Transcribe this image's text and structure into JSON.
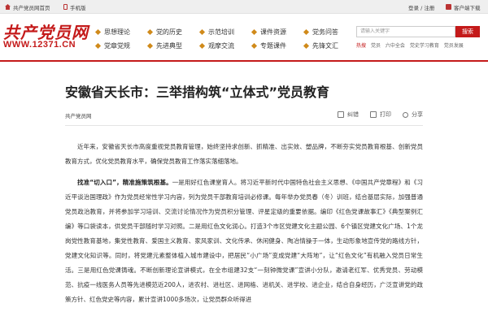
{
  "topbar": {
    "home": "共产党员网首页",
    "mobile": "手机版",
    "auth": "登录 / 注册",
    "download": "客户端下载"
  },
  "logo": {
    "cn": "共产党员网",
    "url": "WWW.12371.CN"
  },
  "nav": [
    "思想理论",
    "党的历史",
    "示范培训",
    "课件资源",
    "党务问答",
    "党章党规",
    "先进典型",
    "观摩交流",
    "专题课件",
    "先锋文汇"
  ],
  "search": {
    "placeholder": "请输入关键字",
    "button": "搜索",
    "hot_label": "热搜",
    "hot_tags": [
      "党员",
      "六中全会",
      "党史学习教育",
      "党员发展"
    ]
  },
  "article": {
    "title": "安徽省天长市：三举措构筑“立体式”党员教育",
    "source": "共产党员网",
    "tools": {
      "correct": "纠错",
      "print": "打印",
      "share": "分享"
    },
    "p1": "近年来，安徽省天长市高度重视党员教育管理，始终坚持求创新、抓精准、出实效、塑品牌，不断夯实党员教育根基、创新党员教育方式，优化党员教育水平，确保党员教育工作落实落细落地。",
    "p2_lead": "找准“切入口”，精准施策筑根基。",
    "p2_body": "一是用好红色课堂育人。将习近平新时代中国特色社会主义思想、《中国共产党章程》和《习近平谈治国理政》作为党员经常性学习内容，列为党员干部教育培训必修课。每年举办党员春（冬）训班，结合基层实际，加强普通党员政治教育，并将参加学习培训、交流讨论情况作为党员积分管理、评星定级的重要依据。编印《红色党课故事汇》《典型案例汇编》等口袋读本，供党员干部随时学习对照。二是用红色文化润心。打造3个市区党建文化主题公园、6个镇区党建文化广场、1个龙岗党性教育基地，集党性教育、爱国主义教育、家风家训、文化传承、休闲健身、陶冶情操于一体，生动形象地宣传党的路线方针，党建文化知识等。同时，将党建元素整体植入城市建设中，把居民“小广场”变成党建“大阵地”，让“红色文化”有机融入党员日常生活。三是用红色党课铸魂。不断创新理论宣讲模式，在全市组建32支“一刻钟微党课”宣讲小分队，邀请老红军、优秀党员、劳动模范、抗疫一线医务人员等先进模范近200人，进农村、进社区、进网格、进机关、进学校、进企业，结合自身经历，广泛宣讲党的政策方针、红色党史等内容，累计宣讲1000多场次，让党员群众听得进"
  }
}
